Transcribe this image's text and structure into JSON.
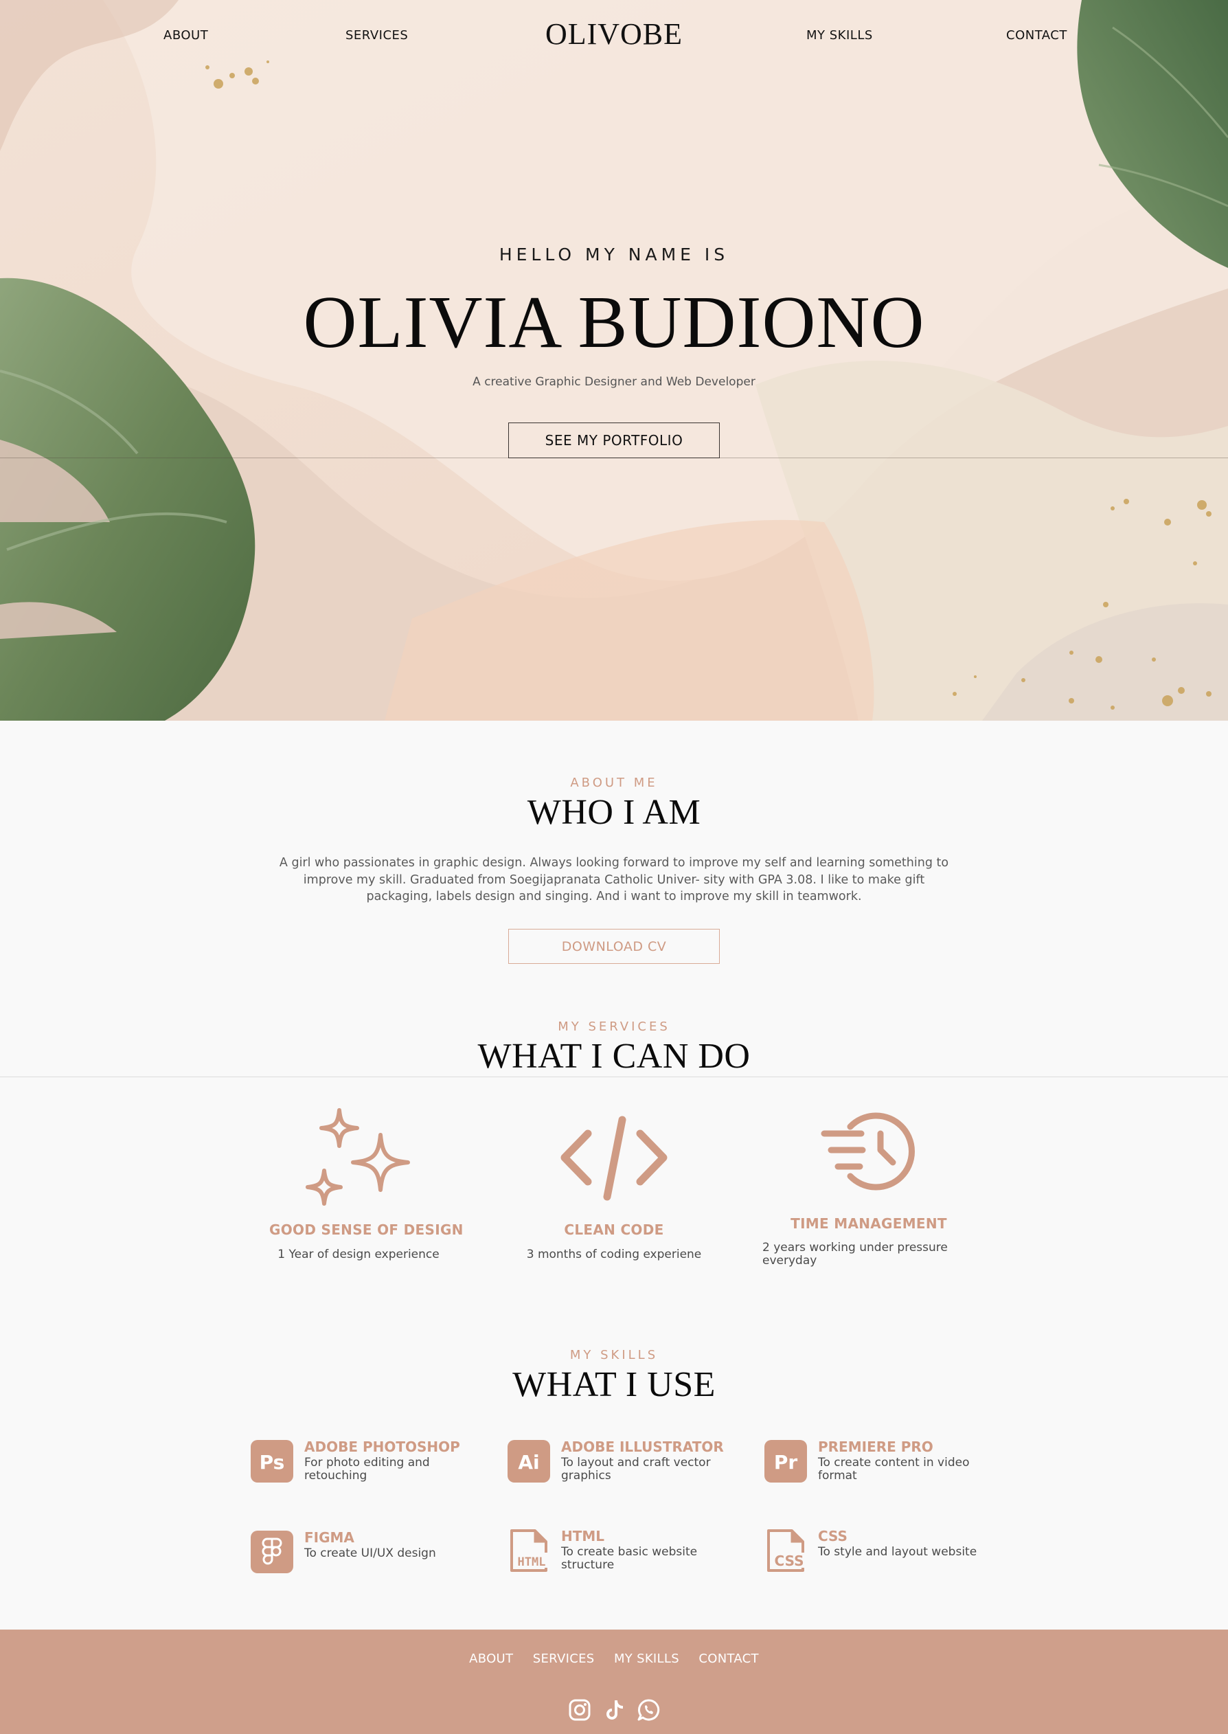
{
  "nav": {
    "about": "ABOUT",
    "services": "SERVICES",
    "logo": "OLIVOBE",
    "skills": "MY SKILLS",
    "contact": "CONTACT"
  },
  "hero": {
    "kicker": "HELLO MY NAME IS",
    "name": "OLIVIA BUDIONO",
    "subtitle": "A creative Graphic Designer and Web Developer",
    "button": "SEE MY PORTFOLIO"
  },
  "about": {
    "kicker": "ABOUT ME",
    "heading": "WHO I AM",
    "text": "A girl who passionates in graphic design. Always looking forward to improve my self and learning something to improve my skill. Graduated from Soegijapranata Catholic Univer- sity with GPA 3.08. I like to make gift packaging, labels design and singing. And i want to improve my skill in teamwork.",
    "button": "DOWNLOAD CV"
  },
  "services": {
    "kicker": "MY SERVICES",
    "heading": "WHAT I CAN DO",
    "items": [
      {
        "icon": "sparkles-icon",
        "title": "GOOD SENSE OF DESIGN",
        "desc": "1 Year of design experience"
      },
      {
        "icon": "code-icon",
        "title": "CLEAN CODE",
        "desc": "3 months of coding experiene"
      },
      {
        "icon": "fast-clock-icon",
        "title": "TIME MANAGEMENT",
        "desc": "2 years working under pressure everyday"
      }
    ]
  },
  "skills": {
    "kicker": "MY SKILLS",
    "heading": "WHAT I USE",
    "items": [
      {
        "icon": "photoshop-icon",
        "badge": "Ps",
        "title": "ADOBE PHOTOSHOP",
        "desc": "For photo editing and retouching"
      },
      {
        "icon": "illustrator-icon",
        "badge": "Ai",
        "title": "ADOBE ILLUSTRATOR",
        "desc": "To layout and craft vector graphics"
      },
      {
        "icon": "premiere-icon",
        "badge": "Pr",
        "title": "PREMIERE PRO",
        "desc": "To create content in video format"
      },
      {
        "icon": "figma-icon",
        "badge": "",
        "title": "FIGMA",
        "desc": "To create UI/UX design"
      },
      {
        "icon": "html-file-icon",
        "badge": "HTML",
        "title": "HTML",
        "desc": "To create basic website structure"
      },
      {
        "icon": "css-file-icon",
        "badge": "CSS",
        "title": "CSS",
        "desc": "To style and layout website"
      }
    ]
  },
  "footer": {
    "links": [
      "ABOUT",
      "SERVICES",
      "MY SKILLS",
      "CONTACT"
    ],
    "social": [
      "instagram-icon",
      "tiktok-icon",
      "whatsapp-icon"
    ]
  },
  "colors": {
    "accent": "#cf9b84",
    "footer_bg": "#cf9f8b",
    "leaf": "#6f8a5c"
  }
}
